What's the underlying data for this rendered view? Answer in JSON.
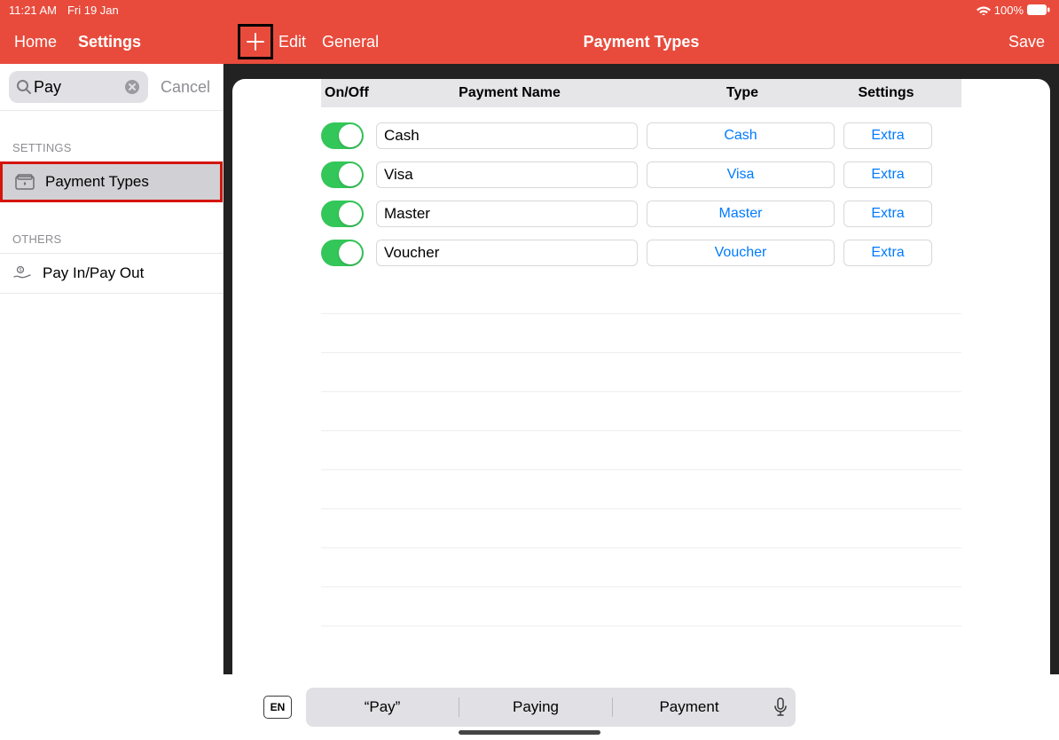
{
  "statusbar": {
    "time": "11:21 AM",
    "date": "Fri 19 Jan",
    "battery_pct": "100%"
  },
  "header": {
    "home": "Home",
    "settings": "Settings",
    "edit": "Edit",
    "general": "General",
    "title": "Payment Types",
    "save": "Save"
  },
  "search": {
    "value": "Pay",
    "cancel": "Cancel"
  },
  "sidebar": {
    "section_settings": "SETTINGS",
    "item_payment_types": "Payment Types",
    "section_others": "OTHERS",
    "item_payinout": "Pay In/Pay Out"
  },
  "table": {
    "head_onoff": "On/Off",
    "head_name": "Payment Name",
    "head_type": "Type",
    "head_settings": "Settings",
    "rows": [
      {
        "name": "Cash",
        "type": "Cash",
        "settings": "Extra"
      },
      {
        "name": "Visa",
        "type": "Visa",
        "settings": "Extra"
      },
      {
        "name": "Master",
        "type": "Master",
        "settings": "Extra"
      },
      {
        "name": "Voucher",
        "type": "Voucher",
        "settings": "Extra"
      }
    ]
  },
  "keyboard": {
    "lang": "EN",
    "suggestions": [
      "“Pay”",
      "Paying",
      "Payment"
    ]
  }
}
